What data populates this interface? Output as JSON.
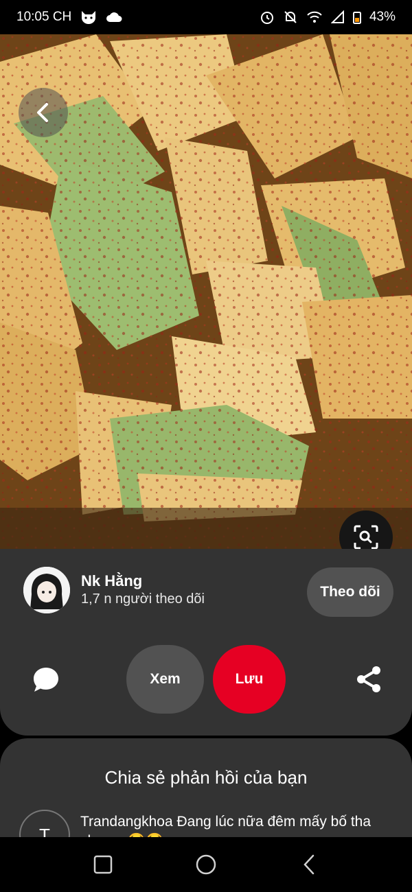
{
  "status_bar": {
    "time": "10:05 CH",
    "battery": "43%",
    "icons": [
      "cat-face-icon",
      "cloud-icon",
      "alarm-icon",
      "notifications-off-icon",
      "wifi-icon",
      "signal-icon",
      "battery-icon"
    ]
  },
  "pin": {
    "author_name": "Nk Hằng",
    "followers": "1,7 n người theo dõi",
    "follow_label": "Theo dõi",
    "view_label": "Xem",
    "save_label": "Lưu"
  },
  "comments": {
    "title": "Chia sẻ phản hồi của bạn",
    "items": [
      {
        "avatar_initial": "T",
        "text": "Trandangkhoa Đang lúc nữa đêm mấy bố tha cho em😂😂"
      }
    ]
  },
  "colors": {
    "save_button": "#e60023",
    "panel": "#333333",
    "secondary_button": "#525252"
  }
}
